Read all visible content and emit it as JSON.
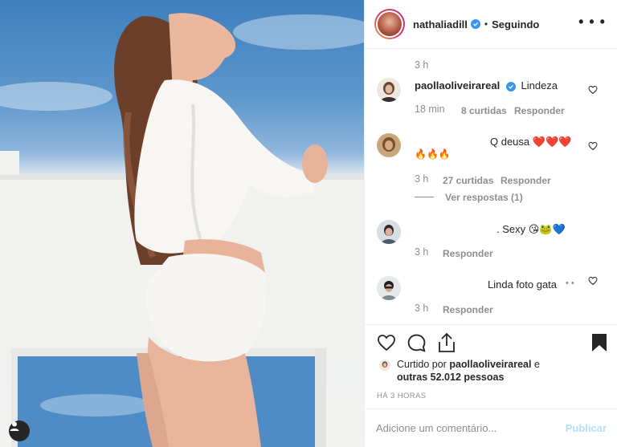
{
  "header": {
    "username": "nathaliadill",
    "separator": "•",
    "follow_status": "Seguindo",
    "more_icon": "more-horizontal-icon"
  },
  "comments": [
    {
      "time_above": "3 h",
      "username": "paollaoliveirareal",
      "verified": true,
      "text": "Lindeza",
      "time": "18 min",
      "likes": "8 curtidas",
      "reply": "Responder"
    },
    {
      "text": "Q deusa",
      "emoji_line1": "❤️❤️❤️",
      "emoji_line2": "🔥🔥🔥",
      "time": "3 h",
      "likes": "27 curtidas",
      "reply": "Responder",
      "view_replies": "Ver respostas (1)"
    },
    {
      "text": ". Sexy",
      "emoji": "😘🐸💙",
      "time": "3 h",
      "reply": "Responder"
    },
    {
      "text": "Linda foto gata",
      "dots": "• •",
      "time": "3 h",
      "reply": "Responder"
    }
  ],
  "likes": {
    "prefix": "Curtido por",
    "user": "paollaoliveirareal",
    "conjunction": "e",
    "others": "outras 52.012 pessoas"
  },
  "time_ago": "HÁ 3 HORAS",
  "add_comment": {
    "placeholder": "Adicione um comentário...",
    "publish": "Publicar"
  },
  "colors": {
    "accent": "#3897f0",
    "publish_disabled": "#b2dffc",
    "heart_red": "#e0245e",
    "muted": "#8e8e8e"
  }
}
